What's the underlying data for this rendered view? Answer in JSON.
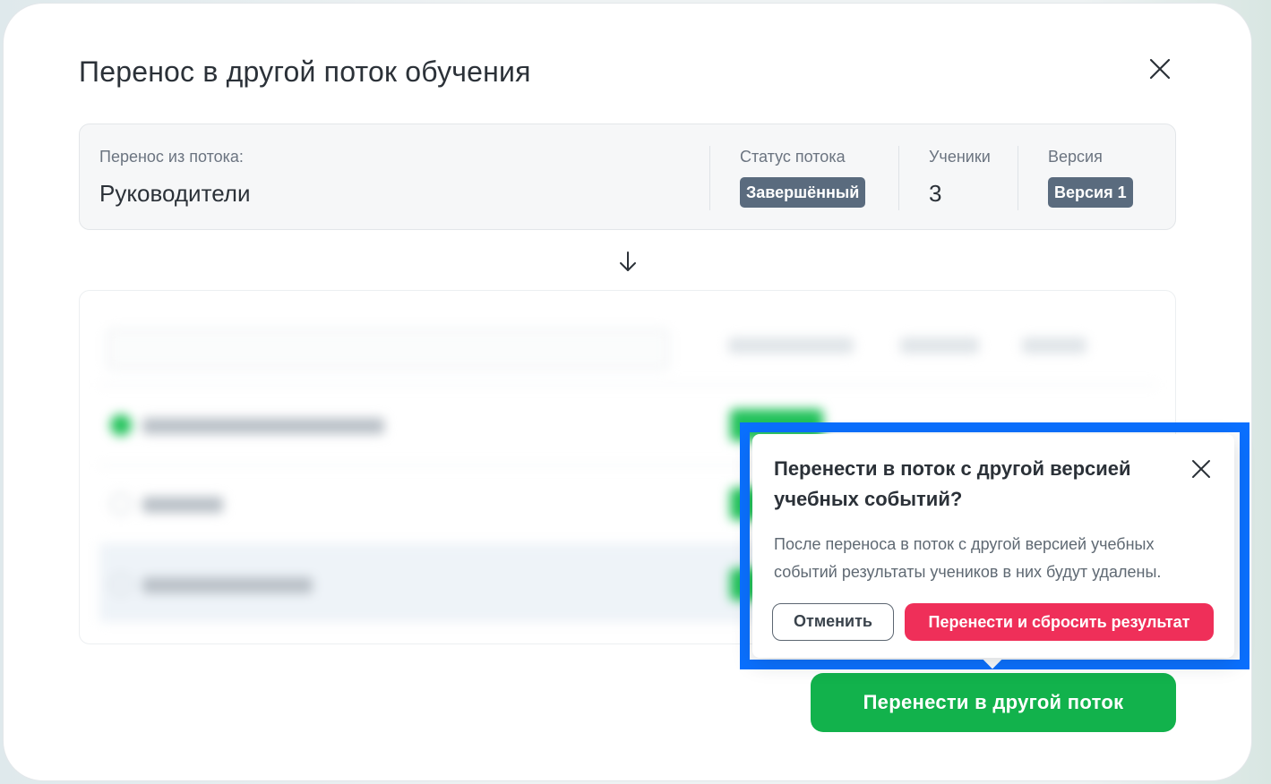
{
  "dialog": {
    "title": "Перенос в другой поток обучения",
    "close_icon": "close-icon"
  },
  "source": {
    "from_label": "Перенос из потока:",
    "from_value": "Руководители",
    "status_label": "Статус потока",
    "status_value": "Завершённый",
    "students_label": "Ученики",
    "students_value": "3",
    "version_label": "Версия",
    "version_value": "Версия 1"
  },
  "arrow_icon": "arrow-down-icon",
  "primary_button": {
    "label": "Перенести в другой поток",
    "color": "#12b24c"
  },
  "popover": {
    "title": "Перенести в поток с другой версией учебных событий?",
    "text": "После переноса в поток с другой версией учебных событий результаты учеников в них будут удалены.",
    "cancel_label": "Отменить",
    "confirm_label": "Перенести и сбросить результат",
    "confirm_color": "#ef2f59",
    "highlight_color": "#0a70ff"
  }
}
